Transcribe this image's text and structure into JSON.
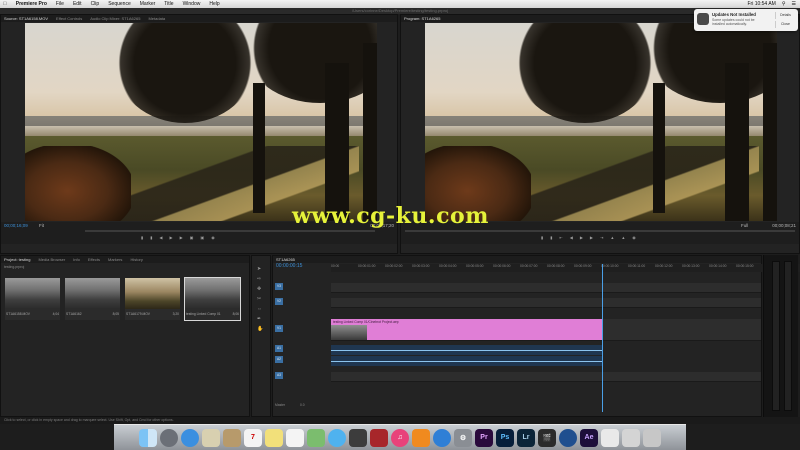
{
  "menubar": {
    "apple": "",
    "app": "Premiere Pro",
    "items": [
      "File",
      "Edit",
      "Clip",
      "Sequence",
      "Marker",
      "Title",
      "Window",
      "Help"
    ],
    "clock": "Fri 10:54 AM"
  },
  "titlebar": {
    "path": "/Users/corinne/Desktop/Premiere/testing/testing.prproj"
  },
  "source_monitor": {
    "tabs": [
      "Source: ST1A6158.MOV",
      "Effect Controls",
      "Audio Clip Mixer: ST1A6265",
      "Metadata"
    ],
    "timecode": "00;00;16;09",
    "fit": "Fit",
    "duration": "00;00;17;20"
  },
  "program_monitor": {
    "tabs": [
      "Program: ST1A6265"
    ],
    "fit": "Full",
    "duration": "00;00;08;21",
    "timecode": "00;00;00;00"
  },
  "project_panel": {
    "tabs": [
      "Project: testing",
      "Media Browser",
      "Info",
      "Effects",
      "Markers",
      "History"
    ],
    "search_value": "testing.prproj",
    "items": [
      {
        "name": "ST1A6158.MOV",
        "duration": "4;04"
      },
      {
        "name": "ST1A6162",
        "duration": "8;05"
      },
      {
        "name": "ST1A6179.MOV",
        "duration": "3;20"
      },
      {
        "name": "testing Linked Comp 01",
        "duration": "8;06"
      }
    ]
  },
  "timeline": {
    "tab": "ST1A6265",
    "timecode": "00:00:00:15",
    "ruler": [
      "00:00",
      "00:00:01:00",
      "00:00:02:00",
      "00:00:03:00",
      "00:00:04:00",
      "00:00:05:00",
      "00:00:06:00",
      "00:00:07:00",
      "00:00:08:00",
      "00:00:09:00",
      "00:00:10:00",
      "00:00:11:00",
      "00:00:12:00",
      "00:00:13:00",
      "00:00:14:00",
      "00:00:15:00"
    ],
    "tracks": [
      "V3",
      "V2",
      "V1",
      "A1",
      "A2",
      "A3",
      "Master"
    ],
    "video_clip": "testing Linked Comp 01/Cinebrot Project.aep",
    "master_value": "0.0"
  },
  "statusbar": "Click to select, or click in empty space and drag to marquee select. Use Shift, Opt, and Cmd for other options.",
  "notification": {
    "title": "Updates Not Installed",
    "message": "Some updates could not be installed automatically.",
    "button1": "Details",
    "button2": "Close"
  },
  "watermark": "www.cg-ku.com",
  "dock": [
    "Finder",
    "Launchpad",
    "Safari",
    "Mail",
    "Contacts",
    "Calendar",
    "Notes",
    "Reminders",
    "Maps",
    "Messages",
    "FaceTime",
    "Photo Booth",
    "iTunes",
    "iBooks",
    "App Store",
    "System Preferences",
    "Pr",
    "Ps",
    "Lr",
    "Fr",
    "",
    "Ae",
    "Docs",
    "Downloads",
    "Trash"
  ]
}
